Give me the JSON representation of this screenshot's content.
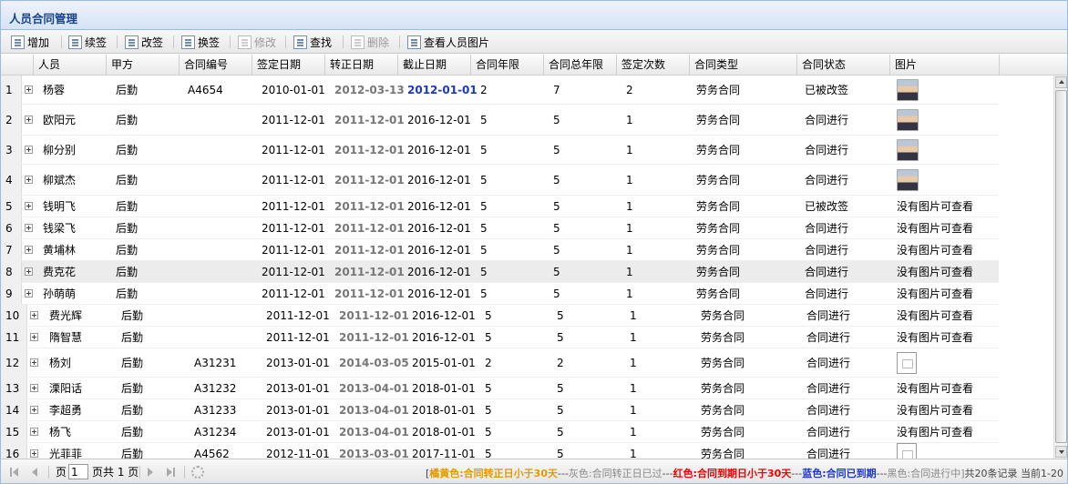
{
  "panel": {
    "title": "人员合同管理"
  },
  "toolbar": {
    "add": "增加",
    "renew": "续签",
    "modify_sign": "改签",
    "change_sign": "换签",
    "edit": "修改",
    "find": "查找",
    "delete": "删除",
    "view_photo": "查看人员图片"
  },
  "columns": {
    "person": "人员",
    "party_a": "甲方",
    "contract_no": "合同编号",
    "sign_date": "签定日期",
    "confirm_date": "转正日期",
    "end_date": "截止日期",
    "years": "合同年限",
    "total_years": "合同总年限",
    "sign_count": "签定次数",
    "type": "合同类型",
    "status": "合同状态",
    "photo": "图片"
  },
  "rows": [
    {
      "n": "1",
      "person": "杨蓉",
      "party_a": "后勤",
      "no": "A4654",
      "sign": "2010-01-01",
      "confirm": "2012-03-13",
      "end": "2012-01-01",
      "years": "2",
      "total": "7",
      "count": "2",
      "type": "劳务合同",
      "status": "已被改签",
      "photo": "photo",
      "photo_text": ""
    },
    {
      "n": "2",
      "person": "欧阳元",
      "party_a": "后勤",
      "no": "",
      "sign": "2011-12-01",
      "confirm": "2011-12-01",
      "end": "2016-12-01",
      "years": "5",
      "total": "5",
      "count": "1",
      "type": "劳务合同",
      "status": "合同进行",
      "photo": "photo",
      "photo_text": ""
    },
    {
      "n": "3",
      "person": "柳分别",
      "party_a": "后勤",
      "no": "",
      "sign": "2011-12-01",
      "confirm": "2011-12-01",
      "end": "2016-12-01",
      "years": "5",
      "total": "5",
      "count": "1",
      "type": "劳务合同",
      "status": "合同进行",
      "photo": "photo",
      "photo_text": ""
    },
    {
      "n": "4",
      "person": "柳斌杰",
      "party_a": "后勤",
      "no": "",
      "sign": "2011-12-01",
      "confirm": "2011-12-01",
      "end": "2016-12-01",
      "years": "5",
      "total": "5",
      "count": "1",
      "type": "劳务合同",
      "status": "合同进行",
      "photo": "photo",
      "photo_text": ""
    },
    {
      "n": "5",
      "person": "钱明飞",
      "party_a": "后勤",
      "no": "",
      "sign": "2011-12-01",
      "confirm": "2011-12-01",
      "end": "2016-12-01",
      "years": "5",
      "total": "5",
      "count": "1",
      "type": "劳务合同",
      "status": "已被改签",
      "photo": "text",
      "photo_text": "没有图片可查看"
    },
    {
      "n": "6",
      "person": "钱梁飞",
      "party_a": "后勤",
      "no": "",
      "sign": "2011-12-01",
      "confirm": "2011-12-01",
      "end": "2016-12-01",
      "years": "5",
      "total": "5",
      "count": "1",
      "type": "劳务合同",
      "status": "合同进行",
      "photo": "text",
      "photo_text": "没有图片可查看"
    },
    {
      "n": "7",
      "person": "黄埔林",
      "party_a": "后勤",
      "no": "",
      "sign": "2011-12-01",
      "confirm": "2011-12-01",
      "end": "2016-12-01",
      "years": "5",
      "total": "5",
      "count": "1",
      "type": "劳务合同",
      "status": "合同进行",
      "photo": "text",
      "photo_text": "没有图片可查看"
    },
    {
      "n": "8",
      "person": "费克花",
      "party_a": "后勤",
      "no": "",
      "sign": "2011-12-01",
      "confirm": "2011-12-01",
      "end": "2016-12-01",
      "years": "5",
      "total": "5",
      "count": "1",
      "type": "劳务合同",
      "status": "合同进行",
      "photo": "text",
      "photo_text": "没有图片可查看"
    },
    {
      "n": "9",
      "person": "孙萌萌",
      "party_a": "后勤",
      "no": "",
      "sign": "2011-12-01",
      "confirm": "2011-12-01",
      "end": "2016-12-01",
      "years": "5",
      "total": "5",
      "count": "1",
      "type": "劳务合同",
      "status": "合同进行",
      "photo": "text",
      "photo_text": "没有图片可查看"
    },
    {
      "n": "10",
      "person": "费光辉",
      "party_a": "后勤",
      "no": "",
      "sign": "2011-12-01",
      "confirm": "2011-12-01",
      "end": "2016-12-01",
      "years": "5",
      "total": "5",
      "count": "1",
      "type": "劳务合同",
      "status": "合同进行",
      "photo": "text",
      "photo_text": "没有图片可查看"
    },
    {
      "n": "11",
      "person": "隋智慧",
      "party_a": "后勤",
      "no": "",
      "sign": "2011-12-01",
      "confirm": "2011-12-01",
      "end": "2016-12-01",
      "years": "5",
      "total": "5",
      "count": "1",
      "type": "劳务合同",
      "status": "合同进行",
      "photo": "text",
      "photo_text": "没有图片可查看"
    },
    {
      "n": "12",
      "person": "杨刘",
      "party_a": "后勤",
      "no": "A31231",
      "sign": "2013-01-01",
      "confirm": "2014-03-05",
      "end": "2015-01-01",
      "years": "2",
      "total": "2",
      "count": "1",
      "type": "劳务合同",
      "status": "合同进行",
      "photo": "doc",
      "photo_text": ""
    },
    {
      "n": "13",
      "person": "溧阳话",
      "party_a": "后勤",
      "no": "A31232",
      "sign": "2013-01-01",
      "confirm": "2013-04-01",
      "end": "2018-01-01",
      "years": "5",
      "total": "5",
      "count": "1",
      "type": "劳务合同",
      "status": "合同进行",
      "photo": "text",
      "photo_text": "没有图片可查看"
    },
    {
      "n": "14",
      "person": "李超勇",
      "party_a": "后勤",
      "no": "A31233",
      "sign": "2013-01-01",
      "confirm": "2013-04-01",
      "end": "2018-01-01",
      "years": "5",
      "total": "5",
      "count": "1",
      "type": "劳务合同",
      "status": "合同进行",
      "photo": "text",
      "photo_text": "没有图片可查看"
    },
    {
      "n": "15",
      "person": "杨飞",
      "party_a": "后勤",
      "no": "A31234",
      "sign": "2013-01-01",
      "confirm": "2013-04-01",
      "end": "2018-01-01",
      "years": "5",
      "total": "5",
      "count": "1",
      "type": "劳务合同",
      "status": "合同进行",
      "photo": "text",
      "photo_text": "没有图片可查看"
    },
    {
      "n": "16",
      "person": "光菲菲",
      "party_a": "后勤",
      "no": "A4562",
      "sign": "2012-11-01",
      "confirm": "2013-03-01",
      "end": "2017-11-01",
      "years": "5",
      "total": "5",
      "count": "1",
      "type": "劳务合同",
      "status": "合同进行",
      "photo": "doc",
      "photo_text": ""
    }
  ],
  "pager": {
    "page_prefix": "页",
    "page_value": "1",
    "page_suffix": "页共 1 页",
    "legend_open": "[",
    "legend_yellow": "橘黄色:合同转正日小于30天",
    "legend_sep1": "---",
    "legend_grey": "灰色:合同转正日已过",
    "legend_sep2": "---",
    "legend_red": "红色:合同到期日小于30天",
    "legend_sep3": "---",
    "legend_blue": "蓝色:合同已到期",
    "legend_sep4": "---",
    "legend_black": "黑色:合同进行中]",
    "records": "共20条记录 当前1-20"
  },
  "colors": {
    "header_title": "#15428b",
    "blue_date": "#1a37cc",
    "grey_date": "#777777"
  }
}
